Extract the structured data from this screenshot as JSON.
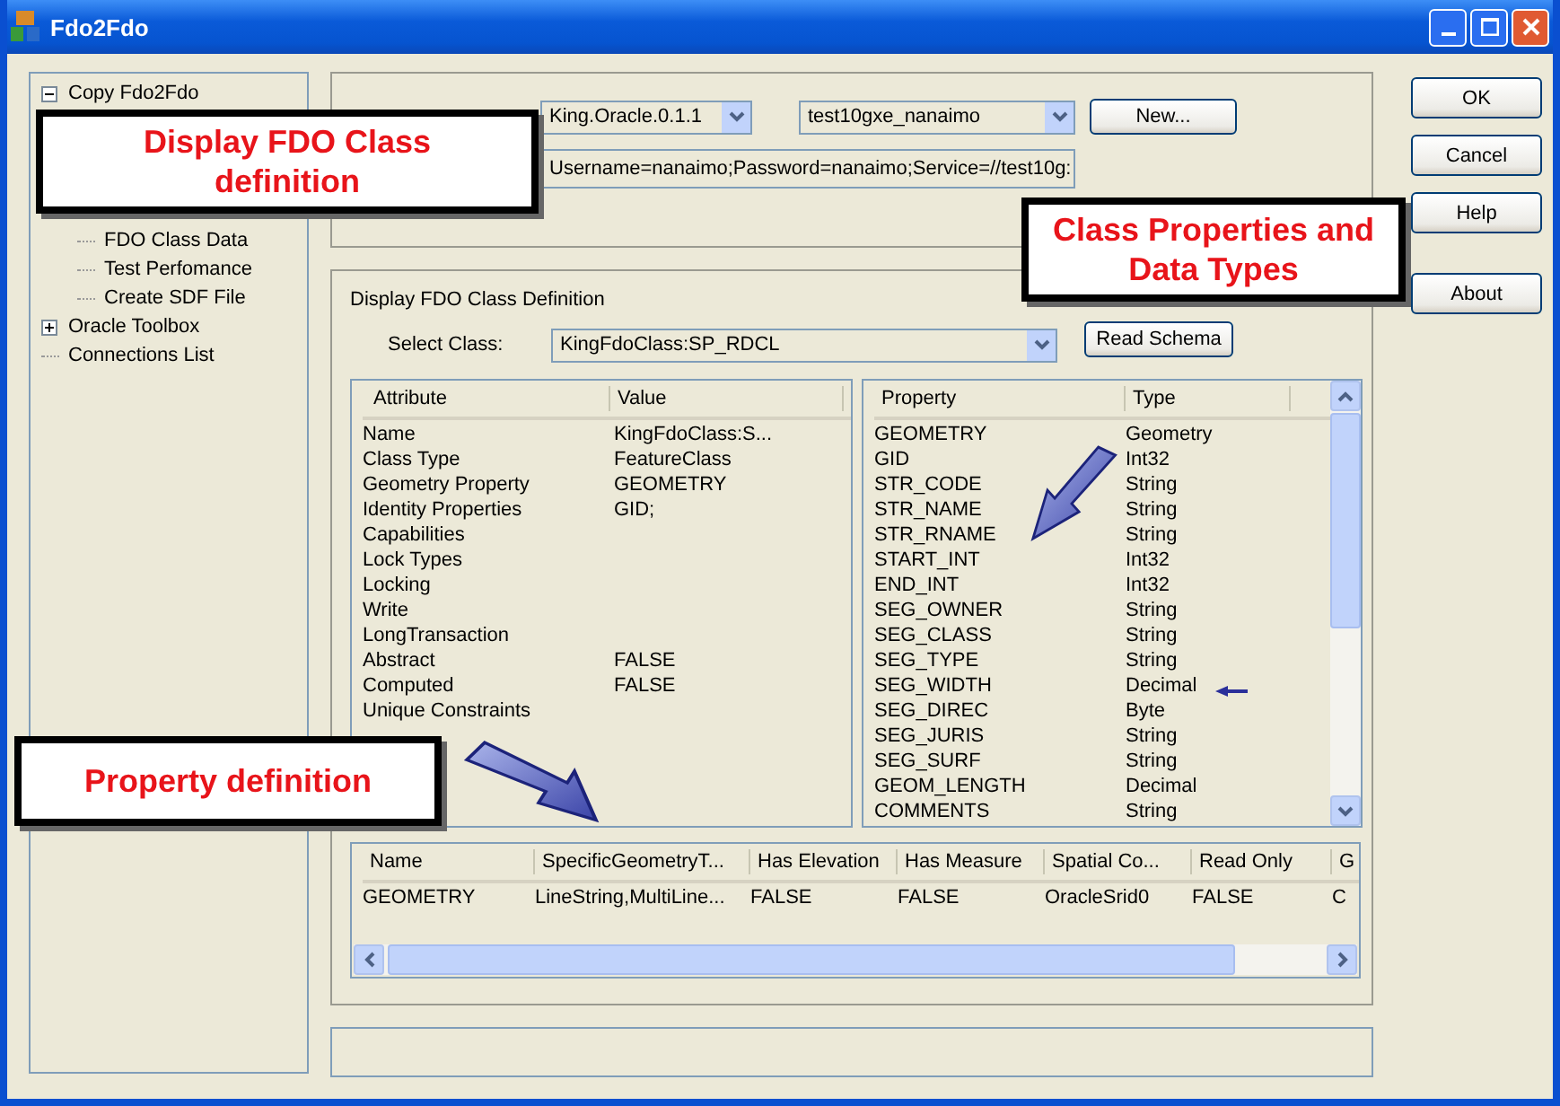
{
  "window": {
    "title": "Fdo2Fdo"
  },
  "tree": [
    {
      "label": "Copy Fdo2Fdo",
      "expanded": true,
      "children": [
        {
          "label": "FDO Class Data"
        },
        {
          "label": "Test Perfomance"
        },
        {
          "label": "Create SDF File"
        }
      ]
    },
    {
      "label": "Oracle Toolbox",
      "expanded": false
    },
    {
      "label": "Connections List"
    }
  ],
  "connection": {
    "provider": "King.Oracle.0.1.1",
    "name": "test10gxe_nanaimo",
    "new_button": "New...",
    "connection_string": "Username=nanaimo;Password=nanaimo;Service=//test10g:"
  },
  "class_group": {
    "title": "Display FDO Class Definition",
    "select_label": "Select Class:",
    "select_value": "KingFdoClass:SP_RDCL",
    "read_button": "Read Schema"
  },
  "attributes": {
    "columns": [
      "Attribute",
      "Value"
    ],
    "rows": [
      [
        "Name",
        "KingFdoClass:S..."
      ],
      [
        "Class Type",
        "FeatureClass"
      ],
      [
        "Geometry Property",
        "GEOMETRY"
      ],
      [
        "Identity Properties",
        "GID;"
      ],
      [
        "Capabilities",
        ""
      ],
      [
        "Lock Types",
        ""
      ],
      [
        "Locking",
        ""
      ],
      [
        "Write",
        ""
      ],
      [
        "LongTransaction",
        ""
      ],
      [
        "Abstract",
        "FALSE"
      ],
      [
        "Computed",
        "FALSE"
      ],
      [
        "Unique Constraints",
        ""
      ]
    ]
  },
  "properties": {
    "columns": [
      "Property",
      "Type"
    ],
    "rows": [
      [
        "GEOMETRY",
        "Geometry"
      ],
      [
        "GID",
        "Int32"
      ],
      [
        "STR_CODE",
        "String"
      ],
      [
        "STR_NAME",
        "String"
      ],
      [
        "STR_RNAME",
        "String"
      ],
      [
        "START_INT",
        "Int32"
      ],
      [
        "END_INT",
        "Int32"
      ],
      [
        "SEG_OWNER",
        "String"
      ],
      [
        "SEG_CLASS",
        "String"
      ],
      [
        "SEG_TYPE",
        "String"
      ],
      [
        "SEG_WIDTH",
        "Decimal"
      ],
      [
        "SEG_DIREC",
        "Byte"
      ],
      [
        "SEG_JURIS",
        "String"
      ],
      [
        "SEG_SURF",
        "String"
      ],
      [
        "GEOM_LENGTH",
        "Decimal"
      ],
      [
        "COMMENTS",
        "String"
      ]
    ]
  },
  "property_detail": {
    "columns": [
      "Name",
      "SpecificGeometryT...",
      "Has Elevation",
      "Has Measure",
      "Spatial Co...",
      "Read Only",
      "G"
    ],
    "rows": [
      [
        "GEOMETRY",
        "LineString,MultiLine...",
        "FALSE",
        "FALSE",
        "OracleSrid0",
        "FALSE",
        "C"
      ]
    ]
  },
  "buttons": [
    "OK",
    "Cancel",
    "Help",
    "About"
  ],
  "callouts": [
    {
      "text": "Display FDO Class definition"
    },
    {
      "text": "Class Properties and Data Types"
    },
    {
      "text": "Property definition"
    }
  ]
}
